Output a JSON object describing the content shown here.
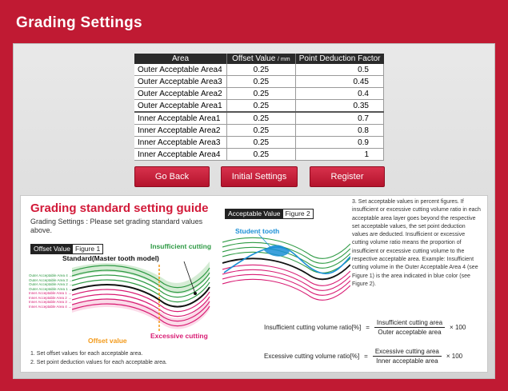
{
  "app": {
    "title": "Grading Settings"
  },
  "table": {
    "headers": {
      "area": "Area",
      "offset": "Offset Value",
      "offset_unit": "/ mm",
      "deduction": "Point Deduction Factor"
    },
    "rows": [
      {
        "area": "Outer Acceptable Area4",
        "offset": "0.25",
        "deduction": "0.5"
      },
      {
        "area": "Outer Acceptable Area3",
        "offset": "0.25",
        "deduction": "0.45"
      },
      {
        "area": "Outer Acceptable Area2",
        "offset": "0.25",
        "deduction": "0.4"
      },
      {
        "area": "Outer Acceptable Area1",
        "offset": "0.25",
        "deduction": "0.35"
      },
      {
        "area": "Inner Acceptable Area1",
        "offset": "0.25",
        "deduction": "0.7"
      },
      {
        "area": "Inner Acceptable Area2",
        "offset": "0.25",
        "deduction": "0.8"
      },
      {
        "area": "Inner Acceptable Area3",
        "offset": "0.25",
        "deduction": "0.9"
      },
      {
        "area": "Inner Acceptable Area4",
        "offset": "0.25",
        "deduction": "1"
      }
    ]
  },
  "buttons": {
    "back": "Go Back",
    "initial": "Initial Settings",
    "register": "Register"
  },
  "guide": {
    "title": "Grading standard setting guide",
    "subtitle": "Grading Settings : Please set grading standard values above.",
    "fig1": {
      "tag_dark": "Offset Value",
      "tag_lite": "Figure 1",
      "insufficient": "Insufficient cutting",
      "standard": "Standard(Master tooth model)",
      "offset_value": "Offset value",
      "excessive": "Excessive cutting"
    },
    "side_labels": [
      "Outer Acceptable Area 4 →",
      "Outer Acceptable Area 3 →",
      "Outer Acceptable Area 2 →",
      "Outer Acceptable Area 1 →",
      "Inner Acceptable Area 1 →",
      "Inner Acceptable Area 2 →",
      "Inner Acceptable Area 3 →",
      "Inner Acceptable Area 4 →"
    ],
    "notes": [
      "1. Set offset values for each acceptable area.",
      "2. Set point deduction values for each acceptable area."
    ],
    "fig2": {
      "tag_dark": "Acceptable Value",
      "tag_lite": "Figure 2",
      "student": "Student tooth"
    },
    "paragraph": "3. Set acceptable values in percent figures. If insufficient or excessive cutting volume ratio in each acceptable area layer goes beyond the respective set acceptable values, the set point deduction values are deducted. Insufficient or excessive cutting volume ratio means the proportion of insufficient or excessive cutting volume to the respective acceptable area. Example: Insufficient cutting volume in the Outer Acceptable Area 4 (see Figure 1) is the area indicated in blue color (see Figure 2).",
    "formula1": {
      "label": "Insufficient cutting volume ratio[%]",
      "eq": "=",
      "num": "Insufficient cutting area",
      "den": "Outer acceptable area",
      "mult": "× 100"
    },
    "formula2": {
      "label": "Excessive cutting volume ratio[%]",
      "eq": "=",
      "num": "Excessive cutting area",
      "den": "Inner acceptable area",
      "mult": "× 100"
    }
  },
  "colors": {
    "brand": "#c01a33",
    "insufficient": "#2e9a44",
    "excessive": "#d81b73",
    "offset": "#f39a1a",
    "student": "#1a8fd6"
  }
}
